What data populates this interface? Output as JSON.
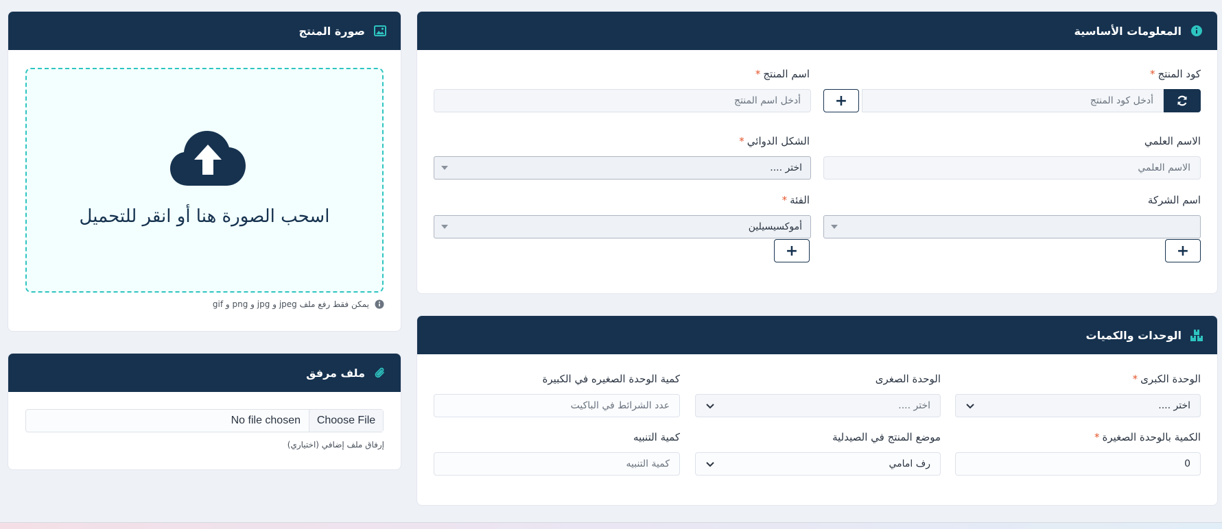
{
  "basic_info": {
    "title": "المعلومات الأساسية",
    "icon": "info-icon",
    "product_code": {
      "label": "كود المنتج",
      "placeholder": "أدخل كود المنتج"
    },
    "product_name": {
      "label": "اسم المنتج",
      "placeholder": "أدخل اسم المنتج"
    },
    "scientific_name": {
      "label": "الاسم العلمي",
      "placeholder": "الاسم العلمي"
    },
    "dosage_form": {
      "label": "الشكل الدوائي",
      "value": "اختر ...."
    },
    "company_name": {
      "label": "اسم الشركة",
      "value": ""
    },
    "category": {
      "label": "الفئة",
      "value": "أموكسيسيلين"
    },
    "required_mark": "*",
    "plus": "+"
  },
  "product_image": {
    "title": "صورة المنتج",
    "icon": "image-icon",
    "dropzone_text": "اسحب الصورة هنا أو انقر للتحميل",
    "hint": "يمكن فقط رفع ملف jpeg و jpg و png و gif"
  },
  "attachment": {
    "title": "ملف مرفق",
    "icon": "paperclip-icon",
    "choose_button": "Choose File",
    "no_file": "No file chosen",
    "hint": "إرفاق ملف إضافي (اختياري)"
  },
  "units": {
    "title": "الوحدات والكميات",
    "icon": "boxes-icon",
    "big_unit": {
      "label": "الوحدة الكبرى",
      "value": "اختر ...."
    },
    "small_unit": {
      "label": "الوحدة الصغرى",
      "value": "اختر ...."
    },
    "small_in_big": {
      "label": "كمية الوحدة الصغيره في الكبيرة",
      "placeholder": "عدد الشرائط في الباكيت"
    },
    "qty_small": {
      "label": "الكمية بالوحدة الصغيرة",
      "value": "0"
    },
    "location": {
      "label": "موضع المنتج في الصيدلية",
      "value": "رف امامي"
    },
    "alert_qty": {
      "label": "كمية التنبيه",
      "placeholder": "كمية التنبيه"
    }
  },
  "colors": {
    "header": "#16324f",
    "accent": "#2ec4c0",
    "required": "#e4572e"
  }
}
